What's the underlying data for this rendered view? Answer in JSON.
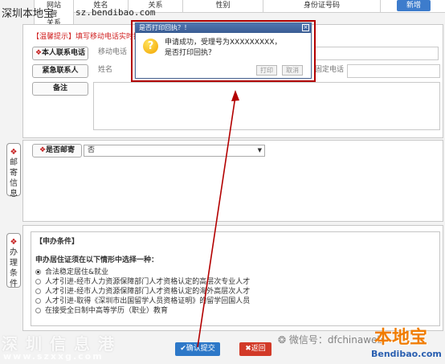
{
  "table": {
    "extra_col": "网站\n管\n关系",
    "headers": [
      "姓名",
      "关系",
      "性别",
      "身份证号码"
    ],
    "add_label": "新增"
  },
  "contact": {
    "hint": "【温馨提示】填写移动电话实时接收",
    "own_phone_label": "本人联系电话",
    "own_phone_value": "移动电话",
    "emergency_label": "紧急联系人",
    "name_placeholder": "姓名",
    "landline_placeholder": "固定电话",
    "remark_label": "备注"
  },
  "mail": {
    "section_label": [
      "邮",
      "寄",
      "信",
      "息"
    ],
    "is_mail_label": "是否邮寄",
    "is_mail_value": "否"
  },
  "conditions": {
    "section_label": [
      "办",
      "理",
      "条",
      "件"
    ],
    "header": "【申办条件】",
    "prompt": "申办居住证须在以下情形中选择一种：",
    "options": [
      {
        "text": "合法稳定居住&就业",
        "checked": true
      },
      {
        "text": "人才引进-经市人力资源保障部门人才资格认定的高层次专业人才",
        "checked": false
      },
      {
        "text": "人才引进-经市人力资源保障部门人才资格认定的海外高层次人才",
        "checked": false
      },
      {
        "text": "人才引进-取得《深圳市出国留学人员资格证明》的留学回国人员",
        "checked": false
      },
      {
        "text": "在接受全日制中高等学历（职业）教育",
        "checked": false
      }
    ]
  },
  "buttons": {
    "confirm": "✔确认提交",
    "back": "✖返回"
  },
  "dialog": {
    "title": "是否打印回执？！",
    "close": "×",
    "message_line1": "申请成功，受理号为XXXXXXXXX，",
    "message_line2": "是否打印回执？",
    "print_label": "打印",
    "cancel_label": "取消"
  },
  "watermarks": {
    "top_left": "深圳本地宝",
    "top_url": "sz.bendibao.com",
    "bottom_cn": "深圳信息港",
    "bottom_url": "www.szxxg.com",
    "wechat": "微信号：dfchinaweb",
    "logo_cn": "本地宝",
    "logo_en": "Bendibao.com"
  },
  "colors": {
    "accent_blue": "#2d78c8",
    "danger_red": "#d23a28",
    "highlight_red": "#b30000"
  }
}
